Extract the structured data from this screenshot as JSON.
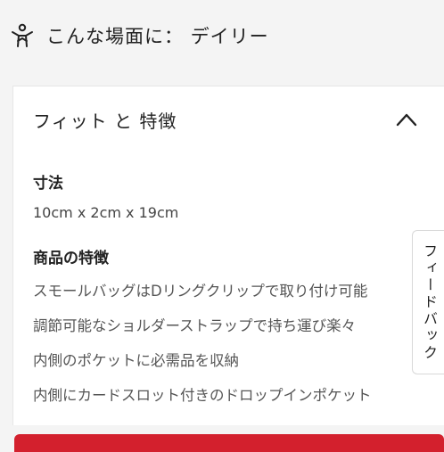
{
  "scene": {
    "label": "こんな場面に： デイリー",
    "icon": "person-stretch-icon"
  },
  "fit_panel": {
    "title": "フィット と 特徴",
    "toggle_icon": "chevron-up-icon",
    "expanded": true,
    "size_label": "寸法",
    "size_value": "10cm x 2cm x 19cm",
    "features_label": "商品の特徴",
    "features": [
      "スモールバッグはDリングクリップで取り付け可能",
      "調節可能なショルダーストラップで持ち運び楽々",
      "内側のポケットに必需品を収納",
      "内側にカードスロット付きのドロップインポケット"
    ]
  },
  "feedback_tab": {
    "label": "フィードバック"
  },
  "colors": {
    "accent": "#d3202d",
    "background": "#f4f4f4",
    "card": "#ffffff"
  }
}
